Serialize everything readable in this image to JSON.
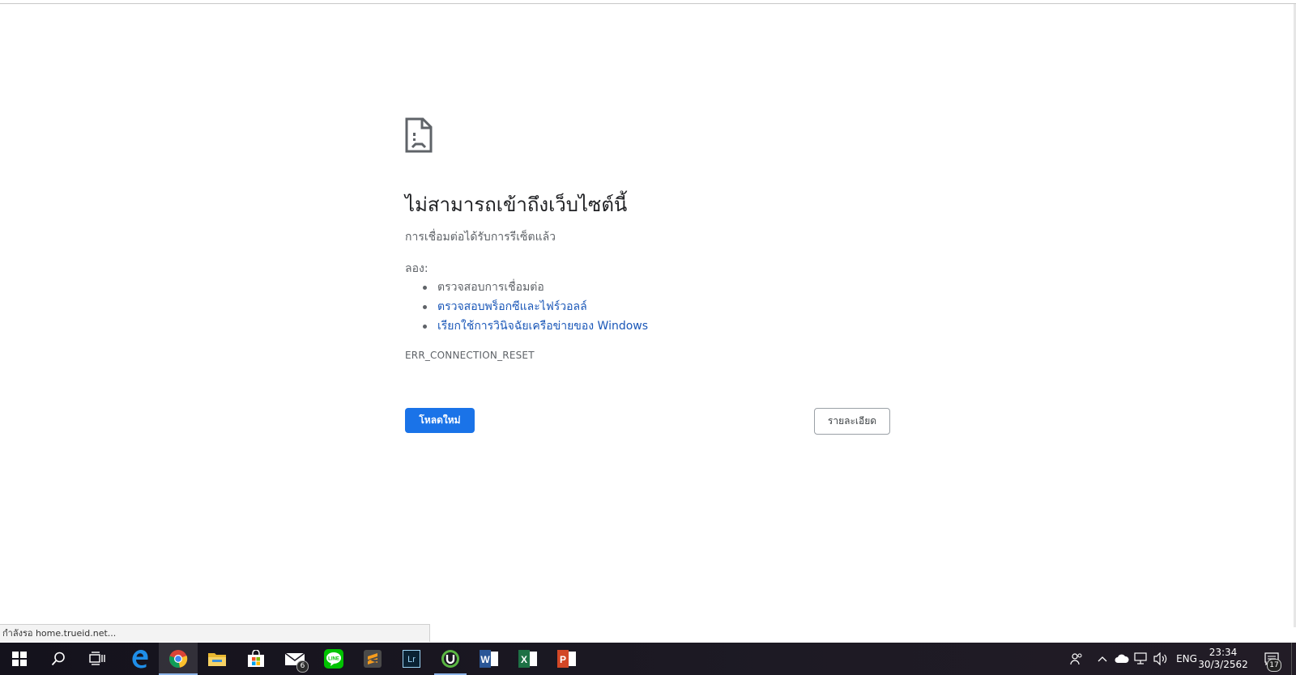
{
  "error_page": {
    "title": "ไม่สามารถเข้าถึงเว็บไซต์นี้",
    "subtitle": "การเชื่อมต่อได้รับการรีเซ็ตแล้ว",
    "try_label": "ลอง:",
    "suggestions": [
      {
        "text": "ตรวจสอบการเชื่อมต่อ",
        "link": false
      },
      {
        "text": "ตรวจสอบพร็อกซีและไฟร์วอลล์",
        "link": true
      },
      {
        "text": "เรียกใช้การวินิจฉัยเครือข่ายของ Windows",
        "link": true
      }
    ],
    "error_code": "ERR_CONNECTION_RESET",
    "reload_button": "โหลดใหม่",
    "details_button": "รายละเอียด"
  },
  "status_bar": {
    "text": "กำลังรอ home.trueid.net..."
  },
  "taskbar": {
    "apps": [
      {
        "name": "start",
        "icon": "windows-logo-icon"
      },
      {
        "name": "search",
        "icon": "search-icon"
      },
      {
        "name": "task-view",
        "icon": "task-view-icon"
      },
      {
        "name": "edge",
        "icon": "edge-icon"
      },
      {
        "name": "chrome",
        "icon": "chrome-icon",
        "state": "active"
      },
      {
        "name": "file-explorer",
        "icon": "folder-icon"
      },
      {
        "name": "store",
        "icon": "store-icon"
      },
      {
        "name": "mail",
        "icon": "mail-icon",
        "badge": "6"
      },
      {
        "name": "line",
        "icon": "line-icon"
      },
      {
        "name": "sublime",
        "icon": "sublime-icon"
      },
      {
        "name": "lightroom",
        "icon": "lightroom-icon",
        "label": "Lr"
      },
      {
        "name": "utorrent",
        "icon": "utorrent-icon",
        "state": "running"
      },
      {
        "name": "word",
        "icon": "word-icon",
        "label": "W"
      },
      {
        "name": "excel",
        "icon": "excel-icon",
        "label": "X"
      },
      {
        "name": "powerpoint",
        "icon": "powerpoint-icon",
        "label": "P"
      }
    ],
    "tray": {
      "language": "ENG",
      "time": "23:34",
      "date": "30/3/2562",
      "notification_count": "17"
    }
  },
  "colors": {
    "link": "#1a57b8",
    "primary_button": "#1a73e8",
    "taskbar": "#1a1722"
  }
}
